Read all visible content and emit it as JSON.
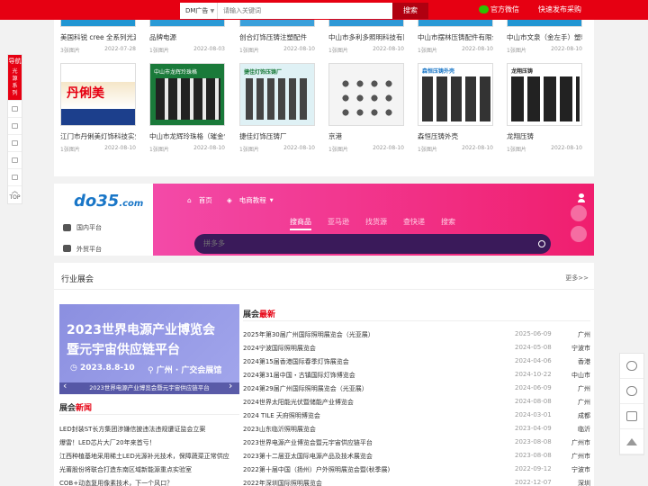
{
  "topbar": {
    "select_label": "DM广告",
    "search_placeholder": "请输入关键词",
    "search_button": "搜索",
    "wechat": "官方微信",
    "publish": "快速发布采购"
  },
  "leftbar": {
    "nav": "导航",
    "series": "光源系列",
    "top": "TOP"
  },
  "products_row1": [
    {
      "name": "美国科锐 cree 全系列光源",
      "count": "3张图片",
      "date": "2022-07-28"
    },
    {
      "name": "品牌电源",
      "count": "1张图片",
      "date": "2022-08-03"
    },
    {
      "name": "创合灯饰压铸注塑配件",
      "count": "1张图片",
      "date": "2022-08-10"
    },
    {
      "name": "中山市多利多照明科技有限",
      "count": "1张图片",
      "date": "2022-08-10"
    },
    {
      "name": "中山市摆林压铸配件有限公",
      "count": "1张图片",
      "date": "2022-08-10"
    },
    {
      "name": "中山市文泉（金左手）塑料",
      "count": "1张图片",
      "date": "2022-08-10"
    }
  ],
  "products_row2": [
    {
      "name": "江门市丹俐美灯饰科技实业",
      "count": "1张图片",
      "date": "2022-08-10",
      "thumb_text": "丹俐美"
    },
    {
      "name": "中山市龙辉玲珠格（璀金包",
      "count": "1张图片",
      "date": "2022-08-10",
      "thumb_text": "中山市龙辉玲珠格"
    },
    {
      "name": "捷佳灯饰压铸厂",
      "count": "1张图片",
      "date": "2022-08-10",
      "thumb_text": "捷佳灯饰压铸厂"
    },
    {
      "name": "京港",
      "count": "1张图片",
      "date": "2022-08-10",
      "thumb_text": ""
    },
    {
      "name": "森恒压铸外壳",
      "count": "1张图片",
      "date": "2022-08-10",
      "thumb_text": "森恒压铸外壳"
    },
    {
      "name": "龙翔压铸",
      "count": "1张图片",
      "date": "2022-08-10",
      "thumb_text": "龙翔压铸"
    }
  ],
  "logo": {
    "main": "do35",
    "suffix": ".com"
  },
  "categories": [
    "国内平台",
    "外贸平台"
  ],
  "banner": {
    "home": "首页",
    "ecommerce": "电商教程",
    "tabs": [
      "搜商品",
      "亚马逊",
      "找货源",
      "查快递",
      "搜索"
    ],
    "search_placeholder": "拼多多"
  },
  "expo": {
    "title": "行业展会",
    "more": "更多>>",
    "poster": {
      "line1": "2023世界电源产业博览会",
      "line2": "暨元宇宙供应链平台",
      "date": "2023.8.8-10",
      "venue": "广州 · 广交会展馆",
      "caption": "2023世界电源产业博览会暨元宇宙供应链平台"
    },
    "news_title_a": "展会",
    "news_title_b": "新闻",
    "news": [
      "LED封装ST长方集团涉嫌信披违法违规遭证监会立案",
      "爆雷！LED芯片大厂20年来首亏！",
      "江西种植基地采用稀土LED光源补光技术，保障蔬菜正常供应",
      "光莆股份将联合打造东南区域新能源重点实验室",
      "COB+动态复用像素技术，下一个风口？"
    ],
    "list_title_a": "展会",
    "list_title_b": "最新",
    "list": [
      {
        "title": "2025年第30届广州国际照明展览会（光亚展）",
        "date": "2025-06-09",
        "city": "广州"
      },
      {
        "title": "2024宁波国际照明展览会",
        "date": "2024-05-08",
        "city": "宁波市"
      },
      {
        "title": "2024第15届香港国际春季灯饰展览会",
        "date": "2024-04-06",
        "city": "香港"
      },
      {
        "title": "2024第31届中国・古镇国际灯饰博览会",
        "date": "2024-10-22",
        "city": "中山市"
      },
      {
        "title": "2024第29届广州国际照明展览会（光亚展）",
        "date": "2024-06-09",
        "city": "广州"
      },
      {
        "title": "2024世界太阳能光伏暨储能产业博览会",
        "date": "2024-08-08",
        "city": "广州"
      },
      {
        "title": "2024 TILE 天府照明博览会",
        "date": "2024-03-01",
        "city": "成都"
      },
      {
        "title": "2023山东临沂照明展览会",
        "date": "2023-04-09",
        "city": "临沂"
      },
      {
        "title": "2023世界电源产业博览会暨元宇宙供应链平台",
        "date": "2023-08-08",
        "city": "广州市"
      },
      {
        "title": "2023第十二届亚太国际电源产品及技术展览会",
        "date": "2023-08-08",
        "city": "广州市"
      },
      {
        "title": "2022第十届中国（扬州）户外照明展览会暨(秋季展)",
        "date": "2022-09-12",
        "city": "宁波市"
      },
      {
        "title": "2022年深圳国际照明展览会",
        "date": "2022-12-07",
        "city": "深圳"
      }
    ]
  },
  "colors": {
    "brand_red": "#e60012",
    "banner_pink": "#f01e6e",
    "link_blue": "#1976c7"
  }
}
